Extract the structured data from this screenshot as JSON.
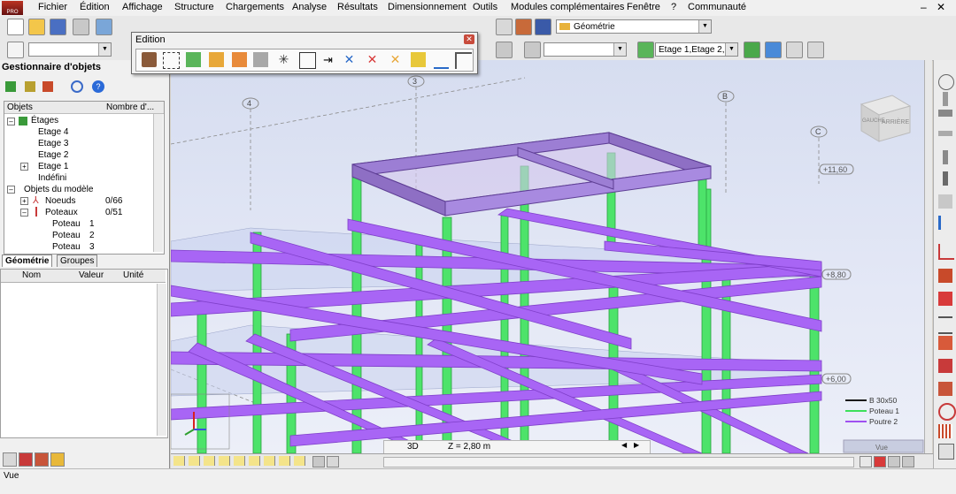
{
  "menu": {
    "items": [
      "Fichier",
      "Édition",
      "Affichage",
      "Structure",
      "Chargements",
      "Analyse",
      "Résultats",
      "Dimensionnement",
      "Outils",
      "Modules complémentaires",
      "Fenêtre",
      "?",
      "Communauté"
    ],
    "window_controls": [
      "–",
      "✕"
    ]
  },
  "toolbar": {
    "view_mode": "Géométrie",
    "stories_selector": "Etage 1,Etage 2,Eta"
  },
  "edition_palette": {
    "title": "Edition",
    "close": "✕"
  },
  "object_manager": {
    "title": "Gestionnaire d'objets",
    "col_objects": "Objets",
    "col_count": "Nombre d'...",
    "tree": {
      "etages": "Étages",
      "etage4": "Etage 4",
      "etage3": "Etage 3",
      "etage2": "Etage 2",
      "etage1": "Etage 1",
      "indefini": "Indéfini",
      "objets_modele": "Objets du modèle",
      "noeuds": "Noeuds",
      "noeuds_count": "0/66",
      "poteaux": "Poteaux",
      "poteaux_count": "0/51",
      "poteau1": "Poteau",
      "poteau1_n": "1",
      "poteau2": "Poteau",
      "poteau2_n": "2",
      "poteau3": "Poteau",
      "poteau3_n": "3"
    },
    "tab_geometry": "Géométrie",
    "tab_groups": "Groupes",
    "props_col_name": "Nom",
    "props_col_value": "Valeur",
    "props_col_unit": "Unité"
  },
  "view3d": {
    "grid_labels": [
      "4",
      "3",
      "B",
      "C"
    ],
    "levels": [
      "+11,60",
      "+8,80",
      "+6,00"
    ],
    "viewcube_faces": [
      "GAUCHE",
      "ARRIÈRE"
    ],
    "legend": [
      {
        "label": "B 30x50",
        "color": "#1a1a1a"
      },
      {
        "label": "Poteau 1",
        "color": "#3ce05a"
      },
      {
        "label": "Poutre 2",
        "color": "#a050f0"
      }
    ],
    "view_tab": "Vue",
    "mode_3d": "3D",
    "z_value": "Z = 2,80 m"
  },
  "colors": {
    "column": "#4de36a",
    "beam": "#a865f5",
    "beam_dark": "#7f3fc9",
    "roof": "#8e6fc4"
  },
  "status": {
    "text": "Vue"
  }
}
